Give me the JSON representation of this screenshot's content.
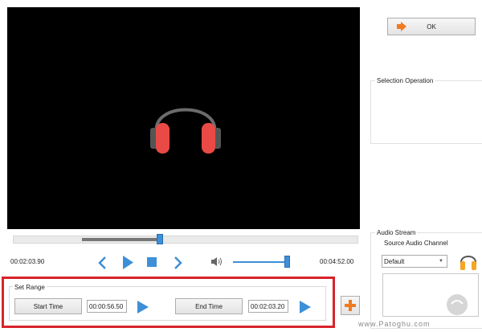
{
  "player": {
    "current_time": "00:02:03.90",
    "total_time": "00:04:52.00",
    "seek_progress": 0.43,
    "volume_level": 0.95
  },
  "set_range": {
    "title": "Set Range",
    "start_label": "Start Time",
    "start_value": "00:00:56.50",
    "end_label": "End Time",
    "end_value": "00:02:03.20"
  },
  "ok_label": "OK",
  "selection_operation": {
    "title": "Selection Operation"
  },
  "audio_stream": {
    "title": "Audio Stream",
    "source_channel_label": "Source Audio Channel",
    "channel_value": "Default"
  },
  "watermark": {
    "text": "www.Patoghu.com"
  },
  "colors": {
    "accent": "#3d8fd8",
    "highlight": "#d8232a",
    "add_button": "#f07a20"
  }
}
